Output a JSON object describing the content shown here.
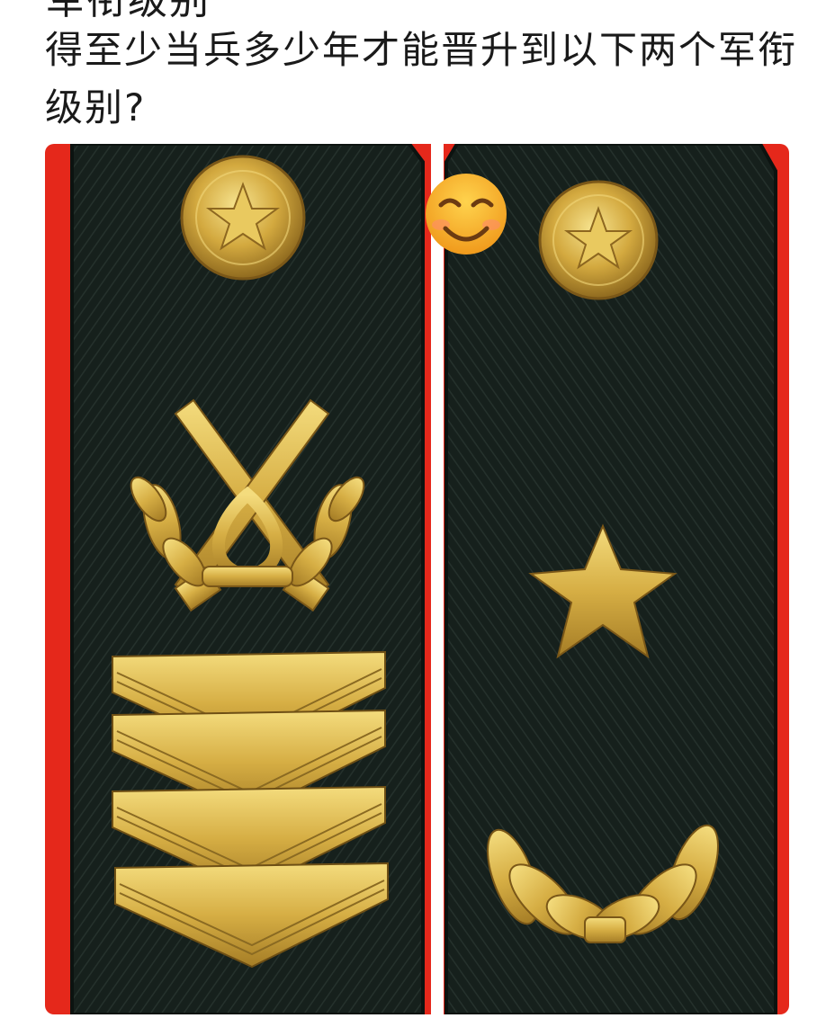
{
  "post": {
    "clipped_title_line": "军衔级别",
    "question": "得至少当兵多少年才能晋升到以下两个军衔级别?"
  },
  "photo": {
    "emoji": "😊",
    "colors": {
      "red_trim": "#e5281b",
      "board_dark": "#16201c",
      "gold": "#d8b24a",
      "gold_light": "#f3db7c",
      "gold_dark": "#9b7624"
    },
    "left_board": {
      "chevron_count": 4
    },
    "right_board": {
      "star_count": 1
    }
  }
}
